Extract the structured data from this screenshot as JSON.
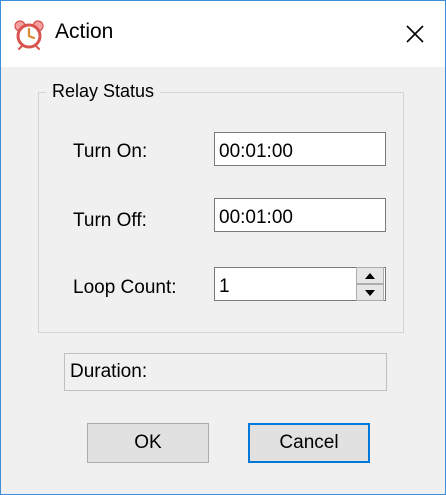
{
  "window": {
    "title": "Action",
    "accent": "#0078d7",
    "icon": "alarm-clock-icon"
  },
  "group": {
    "legend": "Relay Status",
    "turn_on_label": "Turn On:",
    "turn_on_value": "00:01:00",
    "turn_off_label": "Turn Off:",
    "turn_off_value": "00:01:00",
    "loop_count_label": "Loop Count:",
    "loop_count_value": "1"
  },
  "duration": {
    "label": "Duration:"
  },
  "buttons": {
    "ok": "OK",
    "cancel": "Cancel"
  }
}
